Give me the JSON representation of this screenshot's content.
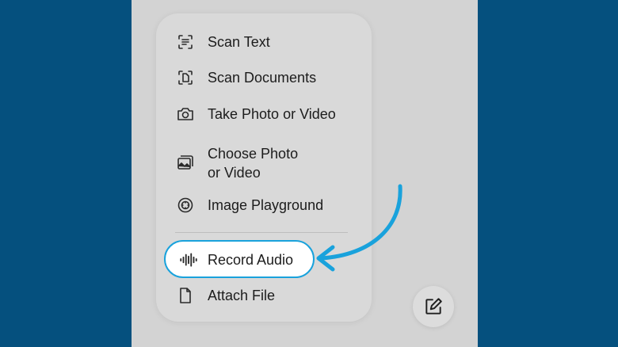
{
  "menu": {
    "items": [
      {
        "label": "Scan Text",
        "icon": "scan-text-icon"
      },
      {
        "label": "Scan Documents",
        "icon": "scan-documents-icon"
      },
      {
        "label": "Take Photo or Video",
        "icon": "camera-icon"
      },
      {
        "label": "Choose Photo\nor Video",
        "icon": "photo-library-icon"
      },
      {
        "label": "Image Playground",
        "icon": "image-playground-icon"
      },
      {
        "label": "Record Audio",
        "icon": "waveform-icon"
      },
      {
        "label": "Attach File",
        "icon": "document-icon"
      }
    ]
  },
  "compose": {
    "icon": "compose-icon"
  },
  "colors": {
    "background": "#05507e",
    "highlight_border": "#19a2dc",
    "arrow": "#19a2dc"
  }
}
